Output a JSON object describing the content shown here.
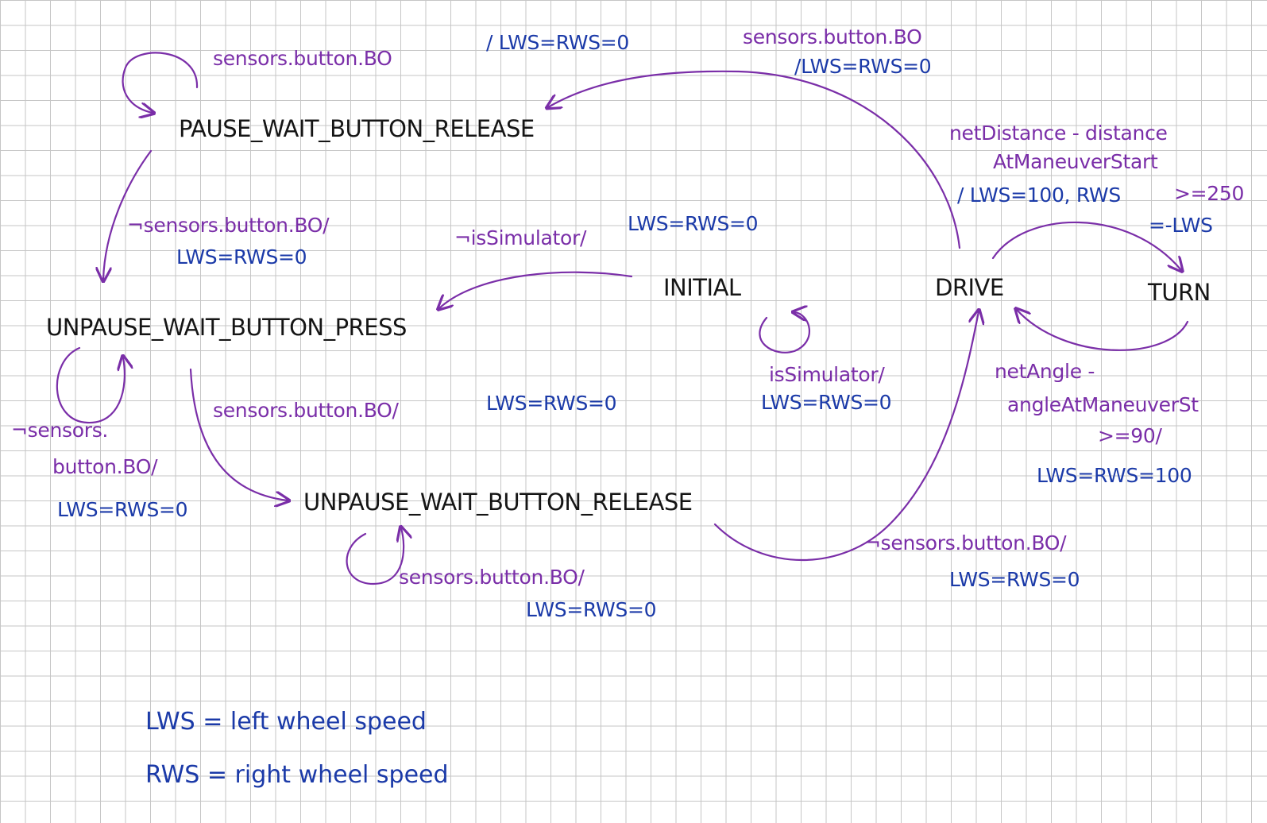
{
  "states": {
    "pause_wait_button_release": "PAUSE_WAIT_BUTTON_RELEASE",
    "unpause_wait_button_press": "UNPAUSE_WAIT_BUTTON_PRESS",
    "unpause_wait_button_release": "UNPAUSE_WAIT_BUTTON_RELEASE",
    "initial": "INITIAL",
    "drive": "DRIVE",
    "turn": "TURN"
  },
  "transitions": {
    "pause_self": {
      "condition": "sensors.button.BO",
      "action": "/ LWS=RWS=0"
    },
    "drive_to_pause": {
      "condition": "sensors.button.BO",
      "action": "/LWS=RWS=0"
    },
    "pause_to_unpause_press": {
      "condition": "¬sensors.button.BO/",
      "action": "LWS=RWS=0"
    },
    "initial_to_unpause_press": {
      "condition": "¬isSimulator/",
      "action": "LWS=RWS=0"
    },
    "unpause_press_self": {
      "condition": "¬sensors.",
      "condition2": "button.BO/",
      "action": "LWS=RWS=0"
    },
    "unpause_press_to_release": {
      "condition": "sensors.button.BO/",
      "action": "LWS=RWS=0"
    },
    "initial_self": {
      "condition": "isSimulator/",
      "action": "LWS=RWS=0"
    },
    "unpause_release_self": {
      "condition": "sensors.button.BO/",
      "action": "LWS=RWS=0"
    },
    "unpause_release_to_drive": {
      "condition": "¬sensors.button.BO/",
      "action": "LWS=RWS=0"
    },
    "drive_to_turn": {
      "condition_line1": "netDistance - distance",
      "condition_line2": "AtManeuverStart",
      "condition_line3": ">=250",
      "action_line1": "/ LWS=100, RWS",
      "action_line2": "=-LWS"
    },
    "turn_to_drive": {
      "condition_line1": "netAngle -",
      "condition_line2": "angleAtManeuverSt",
      "condition_line3": ">=90/",
      "action": "LWS=RWS=100"
    }
  },
  "legend": [
    "LWS = left wheel speed",
    "RWS = right wheel speed"
  ],
  "colors": {
    "condition": "#7a2ea8",
    "action": "#1b3aa8",
    "state": "#151515",
    "grid": "#c6c6c6"
  }
}
